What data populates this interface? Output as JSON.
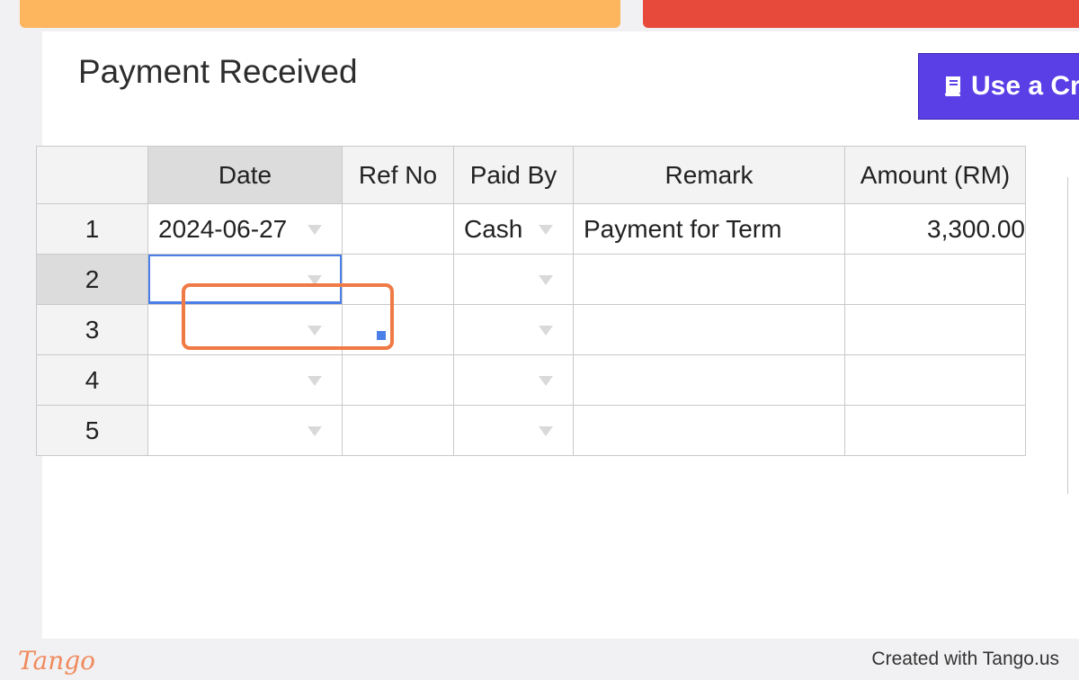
{
  "page": {
    "title": "Payment Received",
    "credit_button_label": "Use a Cre"
  },
  "table": {
    "columns": [
      "",
      "Date",
      "Ref No",
      "Paid By",
      "Remark",
      "Amount (RM)"
    ],
    "rows": [
      {
        "num": "1",
        "date": "2024-06-27",
        "ref_no": "",
        "paid_by": "Cash",
        "remark": "Payment for Term",
        "amount": "3,300.00"
      },
      {
        "num": "2",
        "date": "",
        "ref_no": "",
        "paid_by": "",
        "remark": "",
        "amount": ""
      },
      {
        "num": "3",
        "date": "",
        "ref_no": "",
        "paid_by": "",
        "remark": "",
        "amount": ""
      },
      {
        "num": "4",
        "date": "",
        "ref_no": "",
        "paid_by": "",
        "remark": "",
        "amount": ""
      },
      {
        "num": "5",
        "date": "",
        "ref_no": "",
        "paid_by": "",
        "remark": "",
        "amount": ""
      }
    ]
  },
  "footer": {
    "logo": "Tango",
    "text": "Created with Tango.us"
  },
  "colors": {
    "accent_button": "#5a3ee6",
    "highlight_ring": "#f07a45",
    "active_cell_border": "#4a7fe8",
    "top_bar_orange": "#fdb55e",
    "top_bar_red": "#e74a3b"
  }
}
